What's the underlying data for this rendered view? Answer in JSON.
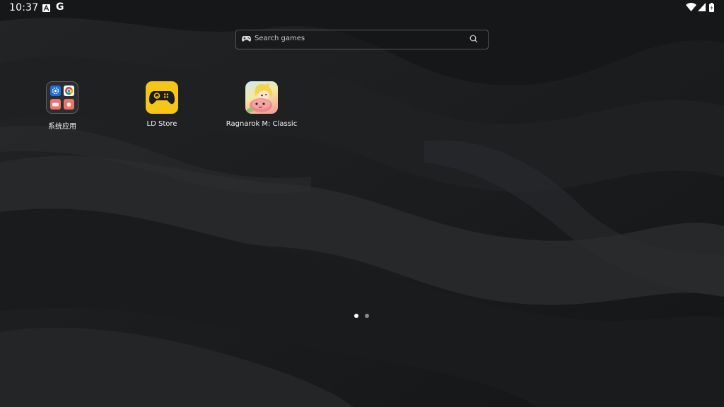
{
  "status_bar": {
    "time": "10:37",
    "left_icons": [
      "a-notification-icon",
      "google-icon"
    ],
    "g_glyph": "G",
    "right_icons": [
      "wifi-icon",
      "cell-signal-icon",
      "battery-icon"
    ]
  },
  "search": {
    "placeholder": "Search games",
    "left_icon": "gamepad-icon",
    "right_icon": "search-icon"
  },
  "apps": [
    {
      "label": "系统应用",
      "icon": "folder-icon"
    },
    {
      "label": "LD Store",
      "icon": "ld-store-gamepad-icon"
    },
    {
      "label": "Ragnarok M: Classic",
      "icon": "ragnarok-game-icon"
    }
  ],
  "folder_contents": [
    "settings-icon",
    "chrome-icon",
    "app-icon",
    "app-icon"
  ],
  "pager": {
    "pages": 2,
    "current": 1
  },
  "colors": {
    "background": "#1c1e20",
    "ld_store_yellow": "#f5c518",
    "dot_active": "#ffffff",
    "dot_inactive": "#8a8c8f"
  }
}
